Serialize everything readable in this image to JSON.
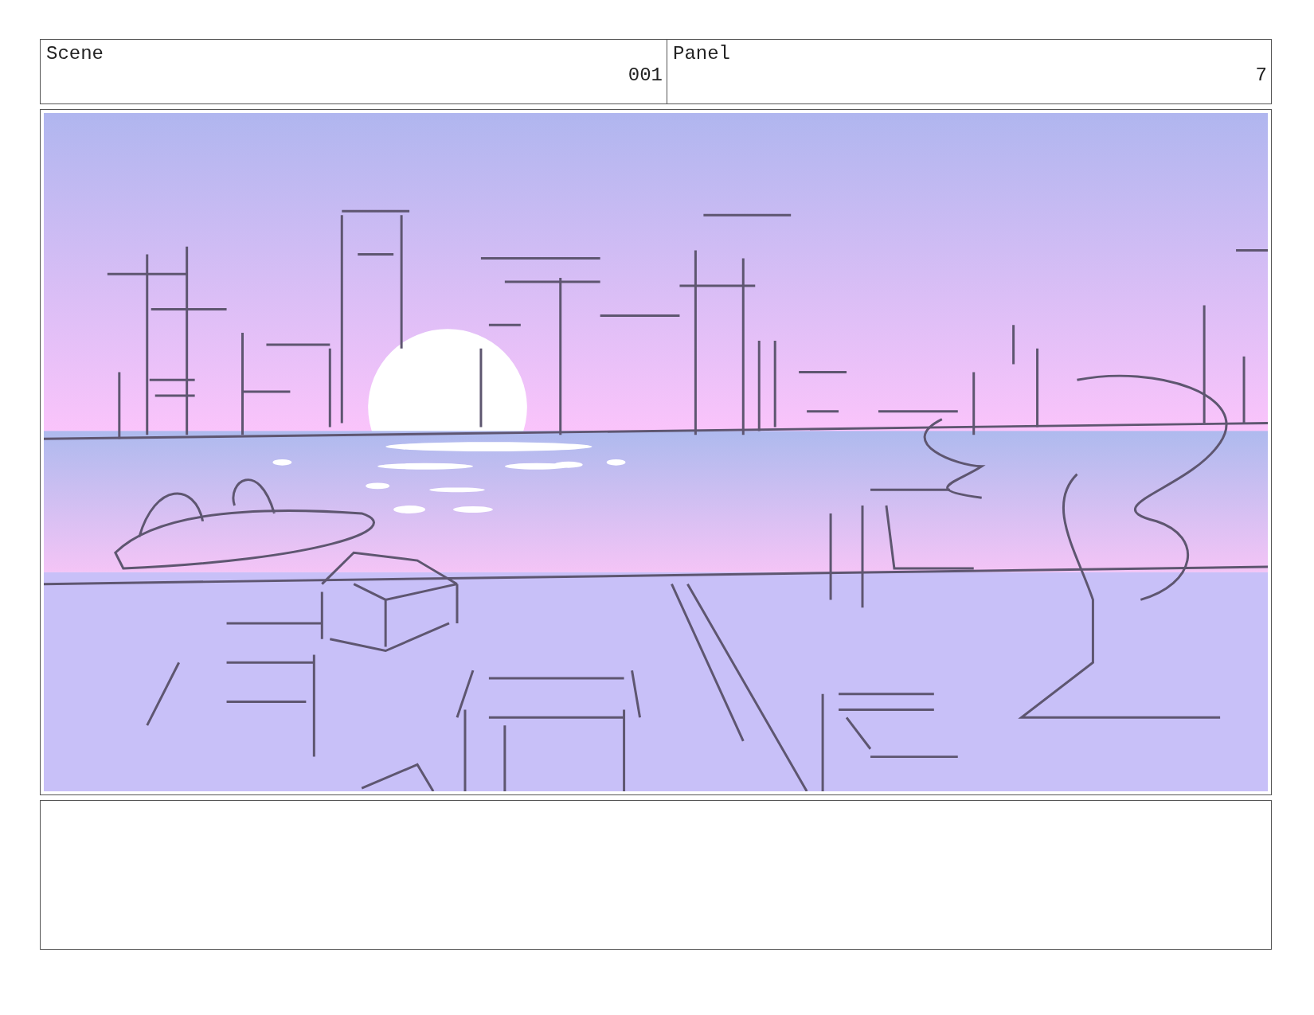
{
  "header": {
    "scene_label": "Scene",
    "scene_number": "001",
    "panel_label": "Panel",
    "panel_number": "7"
  }
}
